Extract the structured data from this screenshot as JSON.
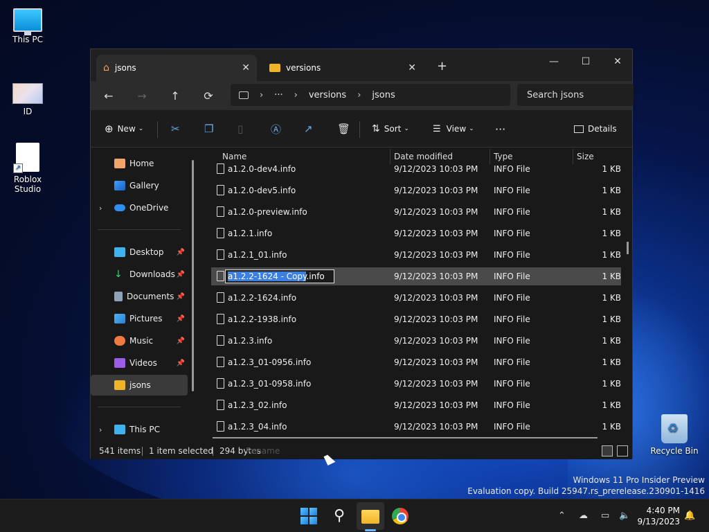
{
  "desktop": {
    "icons": [
      {
        "label": "This PC"
      },
      {
        "label": "ID"
      },
      {
        "label": "Roblox Studio"
      },
      {
        "label": "Recycle Bin"
      }
    ],
    "watermark": {
      "line1": "Windows 11 Pro Insider Preview",
      "line2": "Evaluation copy. Build 25947.rs_prerelease.230901-1416"
    }
  },
  "window": {
    "tabs": [
      {
        "label": "jsons",
        "icon": "home-icon"
      },
      {
        "label": "versions",
        "icon": "folder-icon"
      }
    ],
    "new_tab": "+",
    "controls": {
      "minimize": "—",
      "maximize": "☐",
      "close": "✕"
    },
    "nav": {
      "back": "←",
      "forward": "→",
      "up": "↑",
      "refresh": "⟳"
    },
    "address": {
      "more": "···",
      "crumbs": [
        "versions",
        "jsons"
      ]
    },
    "search_placeholder": "Search jsons",
    "toolbar": {
      "new_label": "New",
      "sort_label": "Sort",
      "view_label": "View",
      "more": "···",
      "details_label": "Details"
    },
    "sidebar": {
      "group1": [
        {
          "label": "Home"
        },
        {
          "label": "Gallery"
        },
        {
          "label": "OneDrive"
        }
      ],
      "group2": [
        {
          "label": "Desktop",
          "pinned": true
        },
        {
          "label": "Downloads",
          "pinned": true
        },
        {
          "label": "Documents",
          "pinned": true
        },
        {
          "label": "Pictures",
          "pinned": true
        },
        {
          "label": "Music",
          "pinned": true
        },
        {
          "label": "Videos",
          "pinned": true
        },
        {
          "label": "jsons",
          "pinned": false
        }
      ],
      "group3": [
        {
          "label": "This PC"
        }
      ]
    },
    "columns": {
      "name": "Name",
      "date": "Date modified",
      "type": "Type",
      "size": "Size"
    },
    "files": [
      {
        "name": "a1.2.0-dev4.info",
        "date": "9/12/2023 10:03 PM",
        "type": "INFO File",
        "size": "1 KB"
      },
      {
        "name": "a1.2.0-dev5.info",
        "date": "9/12/2023 10:03 PM",
        "type": "INFO File",
        "size": "1 KB"
      },
      {
        "name": "a1.2.0-preview.info",
        "date": "9/12/2023 10:03 PM",
        "type": "INFO File",
        "size": "1 KB"
      },
      {
        "name": "a1.2.1.info",
        "date": "9/12/2023 10:03 PM",
        "type": "INFO File",
        "size": "1 KB"
      },
      {
        "name": "a1.2.1_01.info",
        "date": "9/12/2023 10:03 PM",
        "type": "INFO File",
        "size": "1 KB"
      },
      {
        "name": "a1.2.2-1624 - Copy.info",
        "date": "9/12/2023 10:03 PM",
        "type": "INFO File",
        "size": "1 KB",
        "renaming": true,
        "rename_selected": "a1.2.2-1624 - Copy",
        "rename_rest": ".info"
      },
      {
        "name": "a1.2.2-1624.info",
        "date": "9/12/2023 10:03 PM",
        "type": "INFO File",
        "size": "1 KB"
      },
      {
        "name": "a1.2.2-1938.info",
        "date": "9/12/2023 10:03 PM",
        "type": "INFO File",
        "size": "1 KB"
      },
      {
        "name": "a1.2.3.info",
        "date": "9/12/2023 10:03 PM",
        "type": "INFO File",
        "size": "1 KB"
      },
      {
        "name": "a1.2.3_01-0956.info",
        "date": "9/12/2023 10:03 PM",
        "type": "INFO File",
        "size": "1 KB"
      },
      {
        "name": "a1.2.3_01-0958.info",
        "date": "9/12/2023 10:03 PM",
        "type": "INFO File",
        "size": "1 KB"
      },
      {
        "name": "a1.2.3_02.info",
        "date": "9/12/2023 10:03 PM",
        "type": "INFO File",
        "size": "1 KB"
      },
      {
        "name": "a1.2.3_04.info",
        "date": "9/12/2023 10:03 PM",
        "type": "INFO File",
        "size": "1 KB"
      }
    ],
    "status": {
      "items": "541 items",
      "selected": "1 item selected",
      "bytes": "294 bytes",
      "ghost": "Rename"
    }
  },
  "taskbar": {
    "clock_time": "4:40 PM",
    "clock_date": "9/13/2023"
  },
  "colors": {
    "accent": "#3d7fe0",
    "window_bg": "#191919",
    "taskbar_bg": "#1c1c1c"
  }
}
